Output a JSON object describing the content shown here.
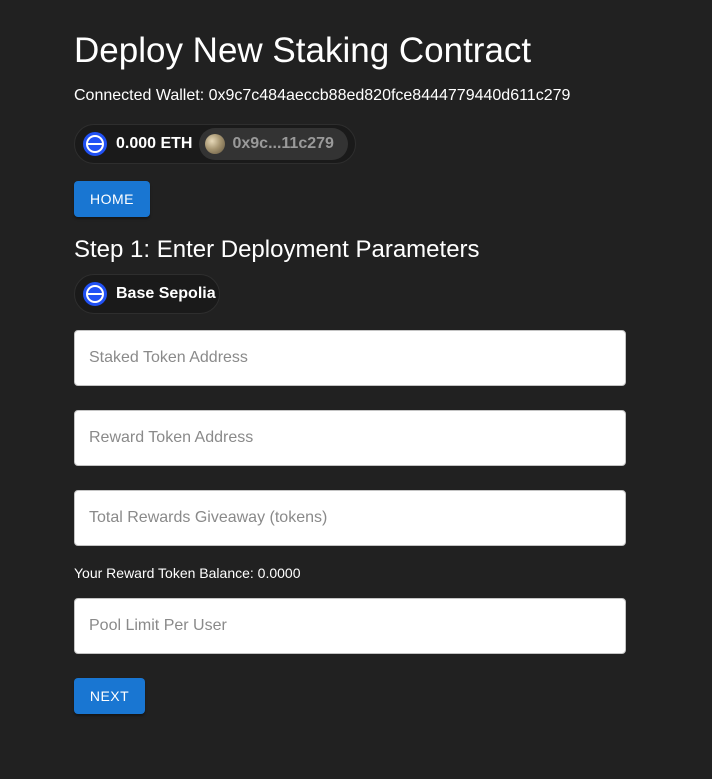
{
  "page": {
    "title": "Deploy New Staking Contract",
    "connected_wallet_label": "Connected Wallet: 0x9c7c484aeccb88ed820fce8444779440d611c279"
  },
  "account": {
    "chain_icon": "base-chain-icon",
    "balance": "0.000 ETH",
    "avatar_icon": "wallet-avatar-icon",
    "address_short": "0x9c...11c279"
  },
  "nav": {
    "home_label": "HOME"
  },
  "step": {
    "title": "Step 1: Enter Deployment Parameters"
  },
  "network": {
    "icon": "base-chain-icon",
    "label": "Base Sepolia"
  },
  "form": {
    "staked_token_placeholder": "Staked Token Address",
    "staked_token_value": "",
    "reward_token_placeholder": "Reward Token Address",
    "reward_token_value": "",
    "total_rewards_placeholder": "Total Rewards Giveaway (tokens)",
    "total_rewards_value": "",
    "reward_balance_label": "Your Reward Token Balance: 0.0000",
    "pool_limit_placeholder": "Pool Limit Per User",
    "pool_limit_value": "",
    "next_label": "NEXT"
  },
  "colors": {
    "background": "#212121",
    "accent": "#1976d2",
    "chain_blue": "#2151f5"
  }
}
